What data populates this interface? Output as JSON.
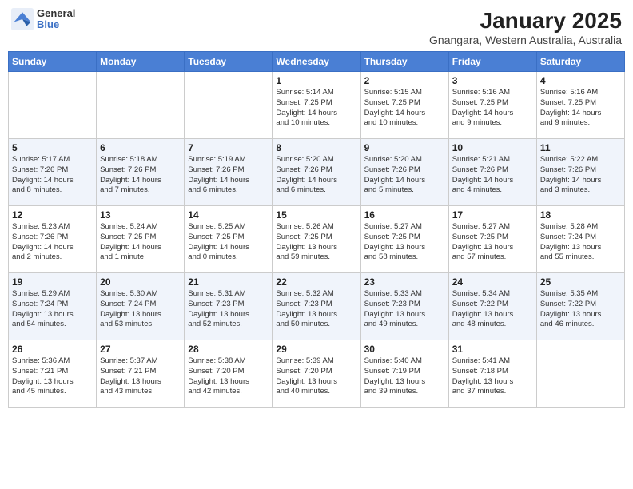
{
  "header": {
    "logo_general": "General",
    "logo_blue": "Blue",
    "month_title": "January 2025",
    "location": "Gnangara, Western Australia, Australia"
  },
  "weekdays": [
    "Sunday",
    "Monday",
    "Tuesday",
    "Wednesday",
    "Thursday",
    "Friday",
    "Saturday"
  ],
  "weeks": [
    [
      {
        "day": "",
        "info": ""
      },
      {
        "day": "",
        "info": ""
      },
      {
        "day": "",
        "info": ""
      },
      {
        "day": "1",
        "info": "Sunrise: 5:14 AM\nSunset: 7:25 PM\nDaylight: 14 hours\nand 10 minutes."
      },
      {
        "day": "2",
        "info": "Sunrise: 5:15 AM\nSunset: 7:25 PM\nDaylight: 14 hours\nand 10 minutes."
      },
      {
        "day": "3",
        "info": "Sunrise: 5:16 AM\nSunset: 7:25 PM\nDaylight: 14 hours\nand 9 minutes."
      },
      {
        "day": "4",
        "info": "Sunrise: 5:16 AM\nSunset: 7:25 PM\nDaylight: 14 hours\nand 9 minutes."
      }
    ],
    [
      {
        "day": "5",
        "info": "Sunrise: 5:17 AM\nSunset: 7:26 PM\nDaylight: 14 hours\nand 8 minutes."
      },
      {
        "day": "6",
        "info": "Sunrise: 5:18 AM\nSunset: 7:26 PM\nDaylight: 14 hours\nand 7 minutes."
      },
      {
        "day": "7",
        "info": "Sunrise: 5:19 AM\nSunset: 7:26 PM\nDaylight: 14 hours\nand 6 minutes."
      },
      {
        "day": "8",
        "info": "Sunrise: 5:20 AM\nSunset: 7:26 PM\nDaylight: 14 hours\nand 6 minutes."
      },
      {
        "day": "9",
        "info": "Sunrise: 5:20 AM\nSunset: 7:26 PM\nDaylight: 14 hours\nand 5 minutes."
      },
      {
        "day": "10",
        "info": "Sunrise: 5:21 AM\nSunset: 7:26 PM\nDaylight: 14 hours\nand 4 minutes."
      },
      {
        "day": "11",
        "info": "Sunrise: 5:22 AM\nSunset: 7:26 PM\nDaylight: 14 hours\nand 3 minutes."
      }
    ],
    [
      {
        "day": "12",
        "info": "Sunrise: 5:23 AM\nSunset: 7:26 PM\nDaylight: 14 hours\nand 2 minutes."
      },
      {
        "day": "13",
        "info": "Sunrise: 5:24 AM\nSunset: 7:25 PM\nDaylight: 14 hours\nand 1 minute."
      },
      {
        "day": "14",
        "info": "Sunrise: 5:25 AM\nSunset: 7:25 PM\nDaylight: 14 hours\nand 0 minutes."
      },
      {
        "day": "15",
        "info": "Sunrise: 5:26 AM\nSunset: 7:25 PM\nDaylight: 13 hours\nand 59 minutes."
      },
      {
        "day": "16",
        "info": "Sunrise: 5:27 AM\nSunset: 7:25 PM\nDaylight: 13 hours\nand 58 minutes."
      },
      {
        "day": "17",
        "info": "Sunrise: 5:27 AM\nSunset: 7:25 PM\nDaylight: 13 hours\nand 57 minutes."
      },
      {
        "day": "18",
        "info": "Sunrise: 5:28 AM\nSunset: 7:24 PM\nDaylight: 13 hours\nand 55 minutes."
      }
    ],
    [
      {
        "day": "19",
        "info": "Sunrise: 5:29 AM\nSunset: 7:24 PM\nDaylight: 13 hours\nand 54 minutes."
      },
      {
        "day": "20",
        "info": "Sunrise: 5:30 AM\nSunset: 7:24 PM\nDaylight: 13 hours\nand 53 minutes."
      },
      {
        "day": "21",
        "info": "Sunrise: 5:31 AM\nSunset: 7:23 PM\nDaylight: 13 hours\nand 52 minutes."
      },
      {
        "day": "22",
        "info": "Sunrise: 5:32 AM\nSunset: 7:23 PM\nDaylight: 13 hours\nand 50 minutes."
      },
      {
        "day": "23",
        "info": "Sunrise: 5:33 AM\nSunset: 7:23 PM\nDaylight: 13 hours\nand 49 minutes."
      },
      {
        "day": "24",
        "info": "Sunrise: 5:34 AM\nSunset: 7:22 PM\nDaylight: 13 hours\nand 48 minutes."
      },
      {
        "day": "25",
        "info": "Sunrise: 5:35 AM\nSunset: 7:22 PM\nDaylight: 13 hours\nand 46 minutes."
      }
    ],
    [
      {
        "day": "26",
        "info": "Sunrise: 5:36 AM\nSunset: 7:21 PM\nDaylight: 13 hours\nand 45 minutes."
      },
      {
        "day": "27",
        "info": "Sunrise: 5:37 AM\nSunset: 7:21 PM\nDaylight: 13 hours\nand 43 minutes."
      },
      {
        "day": "28",
        "info": "Sunrise: 5:38 AM\nSunset: 7:20 PM\nDaylight: 13 hours\nand 42 minutes."
      },
      {
        "day": "29",
        "info": "Sunrise: 5:39 AM\nSunset: 7:20 PM\nDaylight: 13 hours\nand 40 minutes."
      },
      {
        "day": "30",
        "info": "Sunrise: 5:40 AM\nSunset: 7:19 PM\nDaylight: 13 hours\nand 39 minutes."
      },
      {
        "day": "31",
        "info": "Sunrise: 5:41 AM\nSunset: 7:18 PM\nDaylight: 13 hours\nand 37 minutes."
      },
      {
        "day": "",
        "info": ""
      }
    ]
  ]
}
